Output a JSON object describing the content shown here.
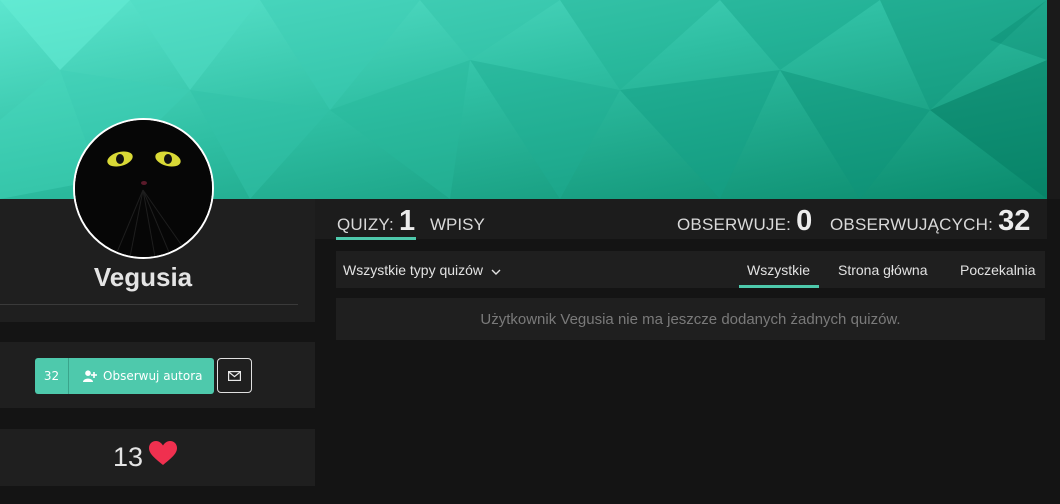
{
  "profile": {
    "username": "Vegusia",
    "avatar": "black-cat-avatar"
  },
  "follow": {
    "count": "32",
    "button_label": "Obserwuj autora",
    "button_icon": "user-plus-icon",
    "message_icon": "envelope-icon"
  },
  "likes": {
    "count": "13",
    "icon": "heart-icon"
  },
  "stats": {
    "quizy_label": "QUIZY:",
    "quizy_value": "1",
    "wpisy_label": "WPISY",
    "obserwuje_label": "OBSERWUJE:",
    "obserwuje_value": "0",
    "obserwujacych_label": "OBSERWUJĄCYCH:",
    "obserwujacych_value": "32"
  },
  "filters": {
    "type_dropdown": "Wszystkie typy quizów",
    "tabs": [
      {
        "label": "Wszystkie",
        "active": true
      },
      {
        "label": "Strona główna",
        "active": false
      },
      {
        "label": "Poczekalnia",
        "active": false
      }
    ]
  },
  "empty_message": "Użytkownik Vegusia nie ma jeszcze dodanych żadnych quizów.",
  "colors": {
    "accent": "#4ec9ac",
    "heart": "#f0304f",
    "background": "#141414",
    "panel": "#1f1f1f"
  }
}
